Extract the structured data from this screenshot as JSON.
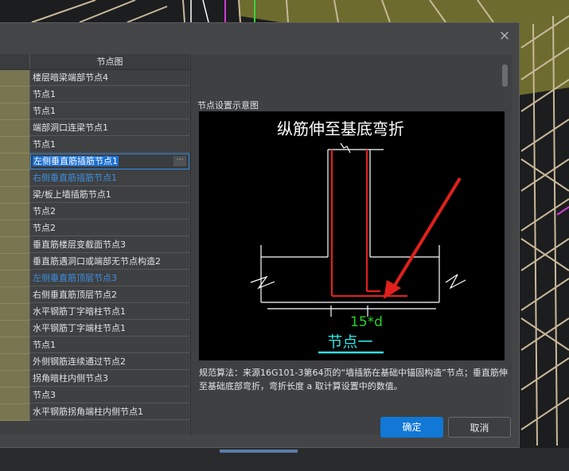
{
  "dialog": {
    "close_label": "×",
    "column_header": "节点图",
    "rows": [
      {
        "label": "楼层暗梁端部节点4",
        "state": "normal"
      },
      {
        "label": "节点1",
        "state": "normal"
      },
      {
        "label": "节点1",
        "state": "normal"
      },
      {
        "label": "端部洞口连梁节点1",
        "state": "normal"
      },
      {
        "label": "节点1",
        "state": "normal"
      },
      {
        "label": "左侧垂直筋插筋节点1",
        "state": "selected"
      },
      {
        "label": "右侧垂直筋插筋节点1",
        "state": "blue"
      },
      {
        "label": "梁/板上墙插筋节点1",
        "state": "normal"
      },
      {
        "label": "节点2",
        "state": "normal"
      },
      {
        "label": "节点2",
        "state": "normal"
      },
      {
        "label": "垂直筋楼层变截面节点3",
        "state": "normal"
      },
      {
        "label": "垂直筋遇洞口或端部无节点构造2",
        "state": "normal"
      },
      {
        "label": "左侧垂直筋顶层节点3",
        "state": "blue"
      },
      {
        "label": "右侧垂直筋顶层节点2",
        "state": "normal"
      },
      {
        "label": "水平钢筋丁字暗柱节点1",
        "state": "normal"
      },
      {
        "label": "水平钢筋丁字端柱节点1",
        "state": "normal"
      },
      {
        "label": "节点1",
        "state": "normal"
      },
      {
        "label": "外侧钢筋连续通过节点2",
        "state": "normal"
      },
      {
        "label": "拐角暗柱内侧节点3",
        "state": "normal"
      },
      {
        "label": "节点3",
        "state": "normal"
      },
      {
        "label": "水平钢筋拐角端柱内侧节点1",
        "state": "normal"
      }
    ],
    "ellipsis_label": "⋯",
    "preview": {
      "label": "节点设置示意图",
      "title": "纵筋伸至基底弯折",
      "dimension": "15*d",
      "caption": "节点一"
    },
    "description": "规范算法：来源16G101-3第64页的“墙插筋在基础中锚固构造”节点；垂直筋伸至基础底部弯折，弯折长度 a 取计算设置中的数值。",
    "ok_label": "确定",
    "cancel_label": "取消"
  },
  "colors": {
    "accent": "#1178d6",
    "link_blue": "#3d8fe0",
    "left_column": "#777651",
    "rebar_red": "#e0201c",
    "dimension_green": "#28d228",
    "caption_cyan": "#2ee0e0"
  }
}
